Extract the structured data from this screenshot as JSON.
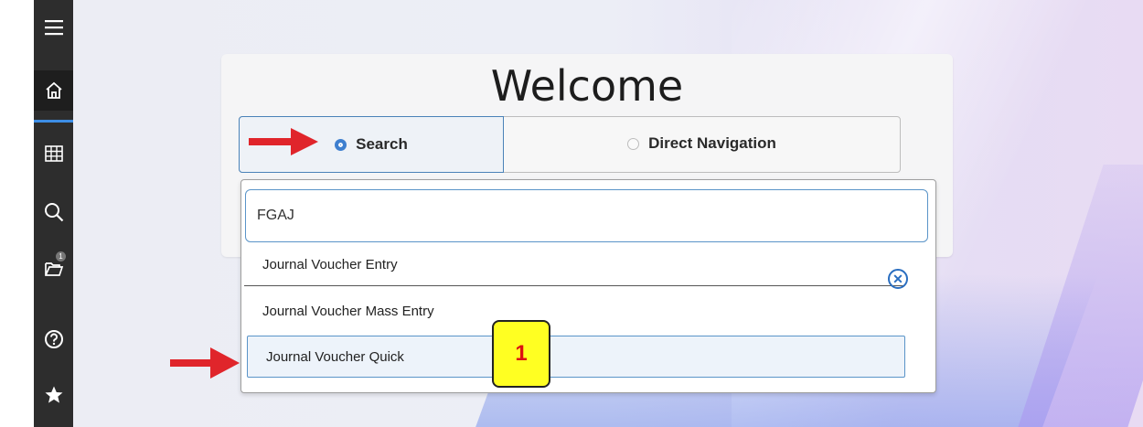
{
  "sidebar": {
    "items": [
      {
        "icon": "menu-icon"
      },
      {
        "icon": "home-icon"
      },
      {
        "icon": "grid-icon"
      },
      {
        "icon": "search-icon"
      },
      {
        "icon": "folder-icon",
        "badge": "1"
      },
      {
        "icon": "help-icon"
      },
      {
        "icon": "star-icon"
      }
    ]
  },
  "welcome": {
    "title": "Welcome",
    "mode_search_label": "Search",
    "mode_direct_label": "Direct Navigation",
    "selected_mode": "Search"
  },
  "search": {
    "value": "FGAJ",
    "results": [
      "Journal Voucher Entry",
      "Journal Voucher Mass Entry",
      "Journal Voucher Quick"
    ],
    "selected_index": 2
  },
  "annotations": {
    "callout_number": "1",
    "arrow_color": "#e0252b"
  },
  "colors": {
    "accent": "#3e7fcf",
    "sidebar_bg": "#2d2d2d",
    "callout_bg": "#ffff22",
    "callout_text": "#dd1111"
  }
}
